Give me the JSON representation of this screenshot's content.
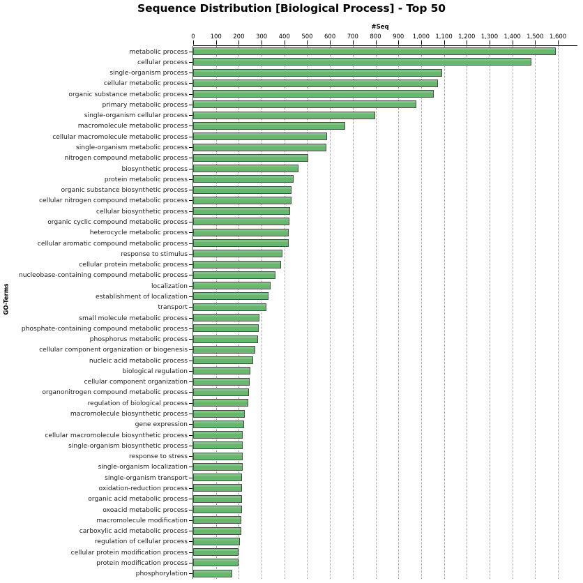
{
  "chart_data": {
    "type": "bar",
    "orientation": "horizontal",
    "title": "Sequence Distribution [Biological Process] - Top 50",
    "xlabel": "#Seq",
    "ylabel": "GO-Terms",
    "xlim": [
      0,
      1600
    ],
    "grid": true,
    "legend": null,
    "bar_color": "#68b76e",
    "bar_edge_color": "#4a4a4a",
    "xticks": [
      0,
      100,
      200,
      300,
      400,
      500,
      600,
      700,
      800,
      900,
      1000,
      1100,
      1200,
      1300,
      1400,
      1500,
      1600
    ],
    "xtick_labels": [
      "0",
      "100",
      "200",
      "300",
      "400",
      "500",
      "600",
      "700",
      "800",
      "900",
      "1,000",
      "1,100",
      "1,200",
      "1,300",
      "1,400",
      "1,500",
      "1,600"
    ],
    "categories": [
      "metabolic process",
      "cellular process",
      "single-organism process",
      "cellular metabolic process",
      "organic substance metabolic process",
      "primary metabolic process",
      "single-organism cellular process",
      "macromolecule metabolic process",
      "cellular macromolecule metabolic process",
      "single-organism metabolic process",
      "nitrogen compound metabolic process",
      "biosynthetic process",
      "protein metabolic process",
      "organic substance biosynthetic process",
      "cellular nitrogen compound metabolic process",
      "cellular biosynthetic process",
      "organic cyclic compound metabolic process",
      "heterocycle metabolic process",
      "cellular aromatic compound metabolic process",
      "response to stimulus",
      "cellular protein metabolic process",
      "nucleobase-containing compound metabolic process",
      "localization",
      "establishment of localization",
      "transport",
      "small molecule metabolic process",
      "phosphate-containing compound metabolic process",
      "phosphorus metabolic process",
      "cellular component organization or biogenesis",
      "nucleic acid metabolic process",
      "biological regulation",
      "cellular component organization",
      "organonitrogen compound metabolic process",
      "regulation of biological process",
      "macromolecule biosynthetic process",
      "gene expression",
      "cellular macromolecule biosynthetic process",
      "single-organism biosynthetic process",
      "response to stress",
      "single-organism localization",
      "single-organism transport",
      "oxidation-reduction process",
      "organic acid metabolic process",
      "oxoacid metabolic process",
      "macromolecule modification",
      "carboxylic acid metabolic process",
      "regulation of cellular process",
      "cellular protein modification process",
      "protein modification process",
      "phosphorylation"
    ],
    "values": [
      1592,
      1485,
      1093,
      1075,
      1055,
      980,
      798,
      667,
      587,
      583,
      505,
      462,
      442,
      432,
      432,
      425,
      422,
      420,
      418,
      392,
      385,
      362,
      340,
      330,
      322,
      292,
      288,
      285,
      272,
      262,
      252,
      248,
      245,
      242,
      225,
      222,
      218,
      218,
      216,
      216,
      214,
      214,
      214,
      213,
      212,
      210,
      205,
      200,
      198,
      171
    ]
  }
}
